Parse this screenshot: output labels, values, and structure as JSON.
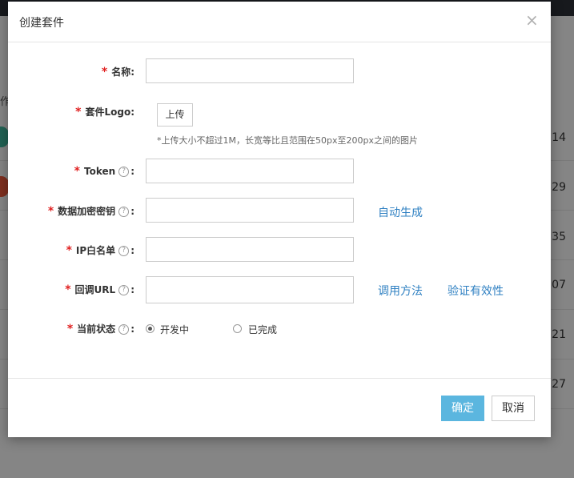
{
  "background": {
    "row_numbers": [
      "14",
      "29",
      "35",
      "07",
      "21",
      "27"
    ],
    "left_fragment": "作"
  },
  "modal": {
    "title": "创建套件",
    "close_glyph": "×",
    "required_mark": "*",
    "help_glyph": "?",
    "fields": {
      "name": {
        "label": "名称:"
      },
      "logo": {
        "label": "套件Logo:",
        "upload_label": "上传",
        "hint": "*上传大小不超过1M，长宽等比且范围在50px至200px之间的图片"
      },
      "token": {
        "label": "Token",
        "colon": ":"
      },
      "encrypt_key": {
        "label": "数据加密密钥",
        "colon": ":",
        "auto_generate_link": "自动生成"
      },
      "ip_whitelist": {
        "label": "IP白名单",
        "colon": ":"
      },
      "callback_url": {
        "label": "回调URL",
        "colon": ":",
        "call_method_link": "调用方法",
        "verify_link": "验证有效性"
      },
      "status": {
        "label": "当前状态",
        "colon": ":",
        "options": [
          {
            "label": "开发中",
            "checked": true
          },
          {
            "label": "已完成",
            "checked": false
          }
        ]
      }
    },
    "footer": {
      "ok_label": "确定",
      "cancel_label": "取消"
    }
  },
  "colors": {
    "accent": "#5bb6df",
    "link": "#2f80c2",
    "required": "#e02020"
  }
}
